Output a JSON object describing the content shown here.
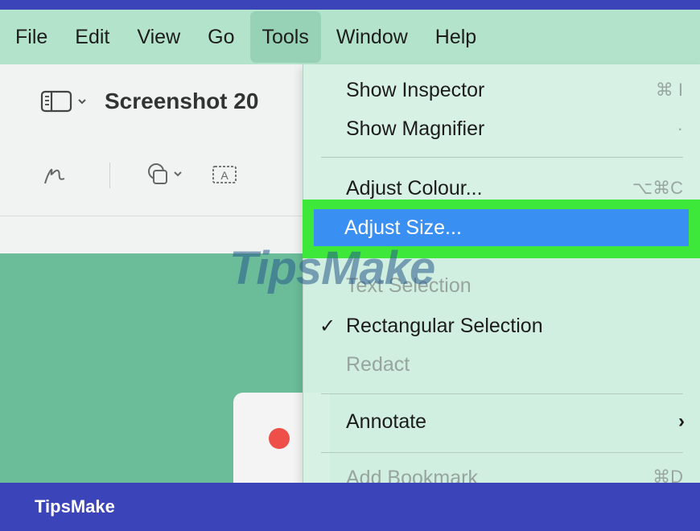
{
  "menubar": {
    "items": [
      "File",
      "Edit",
      "View",
      "Go",
      "Tools",
      "Window",
      "Help"
    ],
    "active": "Tools"
  },
  "document": {
    "title": "Screenshot 20"
  },
  "menu": {
    "show_inspector": {
      "label": "Show Inspector",
      "shortcut": "⌘ I"
    },
    "show_magnifier": {
      "label": "Show Magnifier",
      "shortcut": "·"
    },
    "adjust_colour": {
      "label": "Adjust Colour...",
      "shortcut": "⌥⌘C"
    },
    "adjust_size": {
      "label": "Adjust Size..."
    },
    "text_selection": {
      "label": "Text Selection"
    },
    "rectangular_selection": {
      "label": "Rectangular Selection",
      "check": "✓"
    },
    "redact": {
      "label": "Redact"
    },
    "annotate": {
      "label": "Annotate",
      "arrow": "›"
    },
    "add_bookmark": {
      "label": "Add Bookmark",
      "shortcut": "⌘D"
    }
  },
  "watermark": "TipsMake",
  "footer": {
    "brand": "TipsMake"
  },
  "colors": {
    "menubar": "#b4e3cc",
    "highlight": "#3a8ff2",
    "highlight_border": "#3ee83a",
    "footer": "#3b44b8",
    "canvas": "#6bbd99"
  }
}
